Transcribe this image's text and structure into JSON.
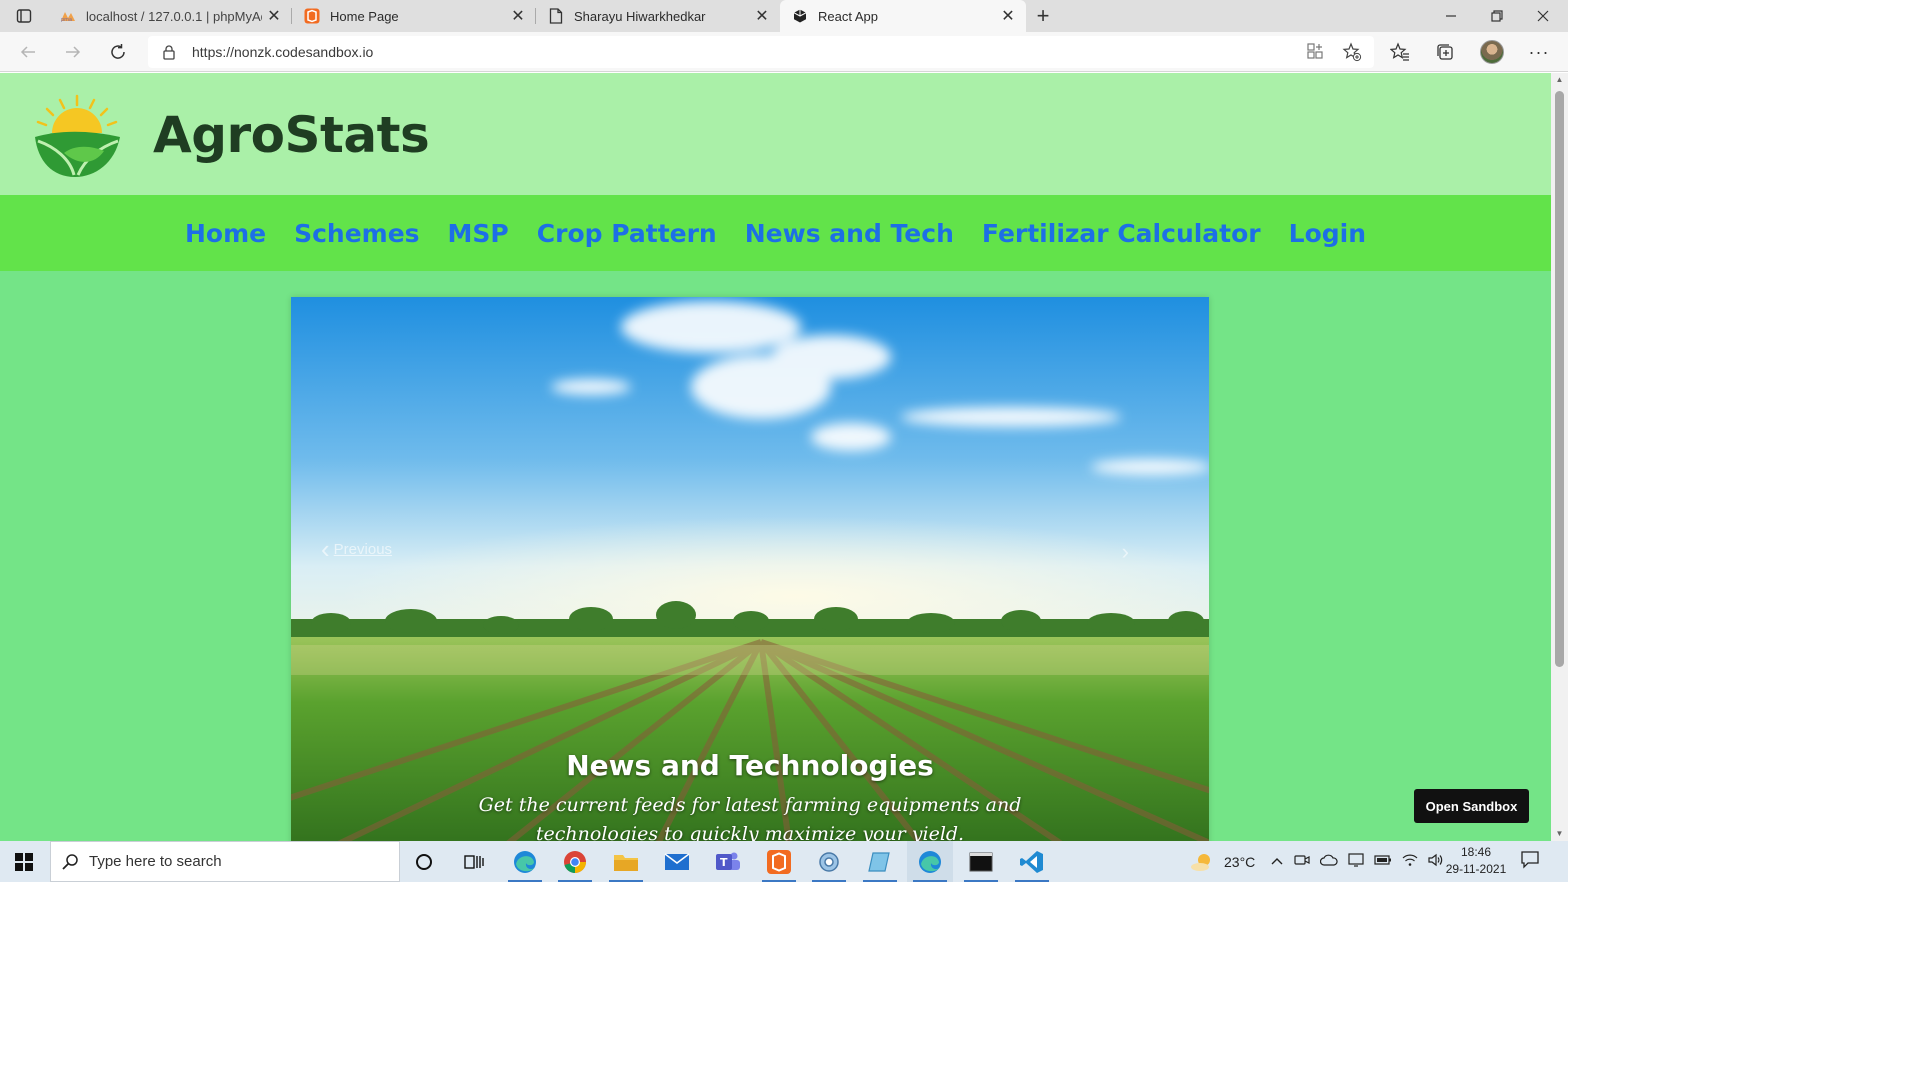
{
  "browser": {
    "tabs": [
      {
        "title": "localhost / 127.0.0.1 | phpMyAdmin",
        "favicon": "phpmyadmin-icon"
      },
      {
        "title": "Home Page",
        "favicon": "codesandbox-orange-icon"
      },
      {
        "title": "Sharayu Hiwarkhedkar",
        "favicon": "document-icon"
      },
      {
        "title": "React App",
        "favicon": "codesandbox-cube-icon",
        "active": true
      }
    ],
    "url": "https://nonzk.codesandbox.io"
  },
  "site": {
    "brand": "AgroStats",
    "nav": [
      "Home",
      "Schemes",
      "MSP",
      "Crop Pattern",
      "News and Tech",
      "Fertilizar Calculator",
      "Login"
    ],
    "carousel": {
      "prev_label": "Previous",
      "caption_title": "News and Technologies",
      "caption_text": "Get the current feeds for latest farming equipments and technologies to quickly maximize your yield."
    },
    "open_sandbox": "Open Sandbox"
  },
  "colors": {
    "page_bg": "#74e487",
    "header_bg": "#aaf0a8",
    "nav_bg": "#62e34a",
    "nav_link": "#1d6fe6",
    "brand_text": "#1f3d22"
  },
  "taskbar": {
    "search_placeholder": "Type here to search",
    "weather": "23°C",
    "time": "18:46",
    "date": "29-11-2021",
    "apps": [
      "cortana",
      "task-view",
      "edge",
      "chrome",
      "file-explorer",
      "mail",
      "teams",
      "codesandbox",
      "control-panel",
      "notepad",
      "edge-active",
      "terminal",
      "vscode"
    ]
  }
}
